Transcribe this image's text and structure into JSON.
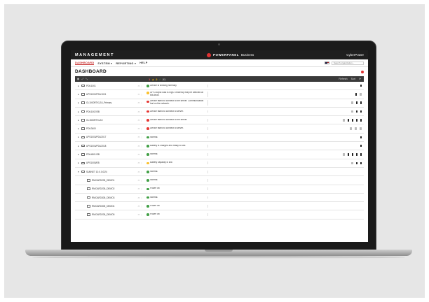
{
  "app": {
    "title": "MANAGEMENT",
    "logo_name": "POWERPANEL",
    "logo_suffix": "Business",
    "user": "CyberPower"
  },
  "nav": {
    "items": [
      {
        "label": "DASHBOARD",
        "active": true
      },
      {
        "label": "SYSTEM ▾"
      },
      {
        "label": "REPORTING ▾"
      },
      {
        "label": "HELP"
      }
    ],
    "search_placeholder": "Search organization..."
  },
  "page": {
    "title": "DASHBOARD"
  },
  "toolbar": {
    "severity": [
      {
        "label": "1",
        "color": "red"
      },
      {
        "label": "▲",
        "color": "amber"
      },
      {
        "label": "2",
        "color": "amber"
      },
      {
        "label": "✓",
        "color": "green"
      },
      {
        "label": "21",
        "color": "grey"
      }
    ],
    "right_labels": [
      "Refresh",
      "Sort",
      "⟳"
    ]
  },
  "rows": [
    {
      "name": "PDU1001",
      "status": "Device is working normally.",
      "status_color": "green",
      "caret": "▸",
      "metrics": [
        "plug"
      ]
    },
    {
      "name": "UPS1002/PDU1001",
      "status": "UPS output load is high. Efficiency may be affected at this level.",
      "status_color": "amber",
      "caret": "▸",
      "metrics": [
        "plug",
        "light"
      ]
    },
    {
      "name": "OL1000RTXL2U_Primary",
      "status": "Device failed to connect to the server. Communication lost on the network.",
      "status_color": "red",
      "caret": "▸",
      "metrics": [
        "light",
        "plug",
        "plug"
      ]
    },
    {
      "name": "PDU1002/EB",
      "status": "Device failed to connect to server.",
      "status_color": "red",
      "caret": "▸",
      "metrics": [
        "light",
        "plug",
        "plug"
      ]
    },
    {
      "name": "OL1500RTXL2U",
      "status": "Device failed to connect to the server.",
      "status_color": "red",
      "caret": "▸",
      "metrics": [
        "light",
        "plug",
        "plug",
        "plug",
        "plug"
      ]
    },
    {
      "name": "PDU3400",
      "status": "Device failed to connect to server.",
      "status_color": "red",
      "caret": "▸",
      "metrics": [
        "light",
        "light",
        "light"
      ]
    },
    {
      "name": "UPS1003/PDU2017",
      "status": "Normal.",
      "status_color": "green",
      "caret": "▸",
      "metrics": [
        "plug"
      ]
    },
    {
      "name": "UPS1004/PDU2018",
      "status": "Battery is charged and ready to use.",
      "status_color": "green",
      "caret": "▸",
      "metrics": [
        "plug"
      ]
    },
    {
      "name": "PDU4501/EB",
      "status": "Normal.",
      "status_color": "green",
      "caret": "▸",
      "metrics": [
        "light",
        "plug",
        "plug",
        "plug",
        "plug"
      ]
    },
    {
      "name": "UPS1005/EB",
      "status": "Battery capacity is low.",
      "status_color": "amber",
      "caret": "▸",
      "metrics": [
        "light",
        "plug",
        "plug"
      ]
    },
    {
      "name": "SUBNET 10.0.0.0/24",
      "status": "Normal.",
      "status_color": "green",
      "caret": "▾",
      "metrics": []
    },
    {
      "name": "RMCARD205_DEMO1",
      "status": "Normal.",
      "status_color": "green",
      "caret": "",
      "child": true,
      "metrics": []
    },
    {
      "name": "RMCARD205_DEMO2",
      "status": "Power off.",
      "status_color": "green",
      "caret": "",
      "child": true,
      "metrics": []
    },
    {
      "name": "RMCARD305_DEMO3",
      "status": "Normal.",
      "status_color": "green",
      "caret": "",
      "child": true,
      "metrics": []
    },
    {
      "name": "RMCARD305_DEMO4",
      "status": "Power off.",
      "status_color": "green",
      "caret": "",
      "child": true,
      "metrics": []
    },
    {
      "name": "RMCARD205_DEMO5",
      "status": "Power off.",
      "status_color": "green",
      "caret": "",
      "child": true,
      "metrics": []
    }
  ],
  "colors": {
    "accent": "#c62828",
    "topbar": "#1f1f1f",
    "status_green": "#43a047",
    "status_red": "#e53935",
    "status_amber": "#fbc02d"
  }
}
